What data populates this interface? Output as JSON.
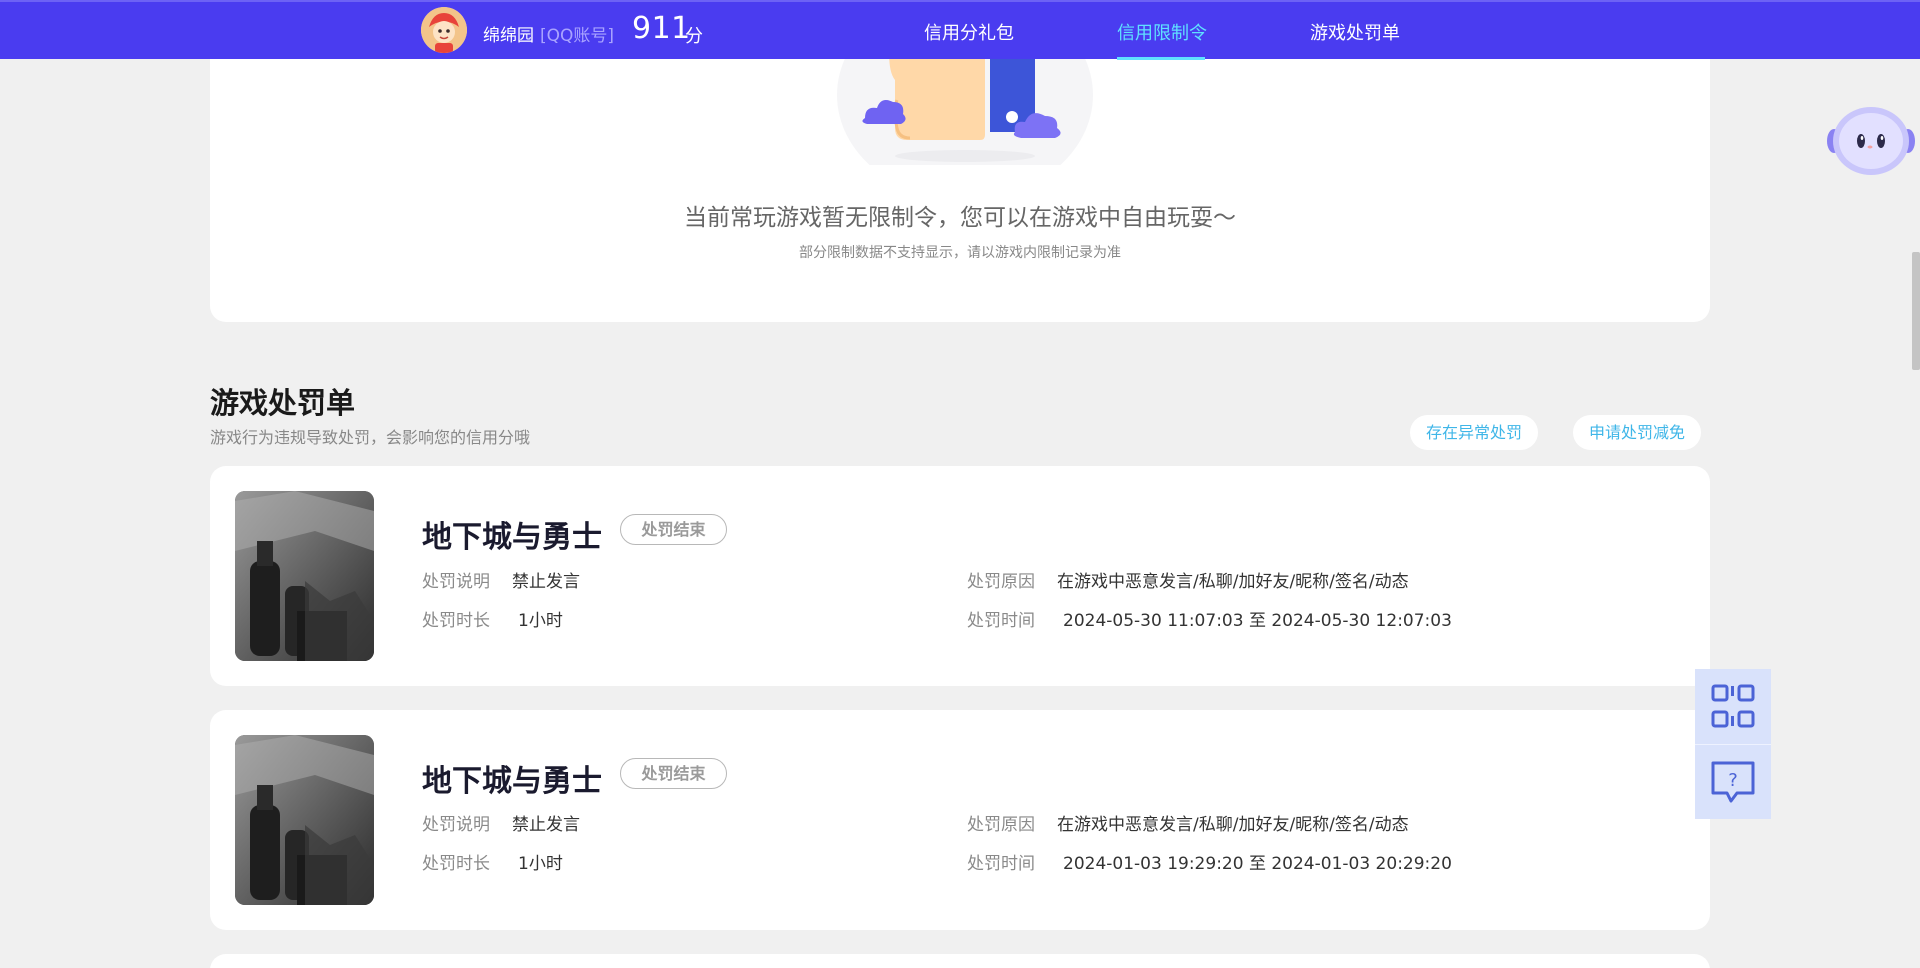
{
  "topbar": {
    "username": "绵绵园",
    "account_type": "[QQ账号]",
    "score": "911",
    "score_unit": "分",
    "nav": [
      {
        "label": "信用分礼包",
        "active": false
      },
      {
        "label": "信用限制令",
        "active": true
      },
      {
        "label": "游戏处罚单",
        "active": false
      }
    ]
  },
  "limit": {
    "message": "当前常玩游戏暂无限制令，您可以在游戏中自由玩耍～",
    "note": "部分限制数据不支持显示，请以游戏内限制记录为准"
  },
  "penalty_section": {
    "title": "游戏处罚单",
    "description": "游戏行为违规导致处罚，会影响您的信用分哦",
    "action_abnormal": "存在异常处罚",
    "action_reduce": "申请处罚减免",
    "labels": {
      "desc": "处罚说明",
      "duration": "处罚时长",
      "reason": "处罚原因",
      "time": "处罚时间"
    },
    "items": [
      {
        "game": "地下城与勇士",
        "status": "处罚结束",
        "desc": "禁止发言",
        "duration": "1小时",
        "reason": "在游戏中恶意发言/私聊/加好友/昵称/签名/动态",
        "time": "2024-05-30 11:07:03 至 2024-05-30 12:07:03"
      },
      {
        "game": "地下城与勇士",
        "status": "处罚结束",
        "desc": "禁止发言",
        "duration": "1小时",
        "reason": "在游戏中恶意发言/私聊/加好友/昵称/签名/动态",
        "time": "2024-01-03 19:29:20 至 2024-01-03 20:29:20"
      }
    ]
  },
  "icons": {
    "qr": "qr-code-icon",
    "help": "help-chat-icon",
    "assistant": "robot-assistant-icon"
  },
  "colors": {
    "topbar": "#4a3cf0",
    "nav_active": "#5fe1ff",
    "pill_text": "#3fb6e8",
    "float_tools": "#d9e2fb"
  }
}
